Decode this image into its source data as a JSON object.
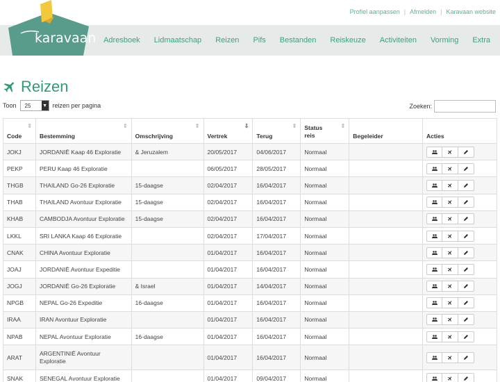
{
  "top_links": [
    "Profiel aanpassen",
    "Afmelden",
    "Karavaan website"
  ],
  "logo_text": "karavaan",
  "nav": [
    "Adresboek",
    "Lidmaatschap",
    "Reizen",
    "Pifs",
    "Bestanden",
    "Reiskeuze",
    "Activiteiten",
    "Vorming",
    "Extra"
  ],
  "page_title": "Reizen",
  "length": {
    "prefix": "Toon",
    "value": "25",
    "suffix": "reizen per pagina"
  },
  "search": {
    "label": "Zoeken:",
    "value": ""
  },
  "columns": [
    "Code",
    "Bestemming",
    "Omschrijving",
    "Vertrek",
    "Terug",
    "Status reis",
    "Begeleider",
    "Acties"
  ],
  "rows": [
    {
      "code": "JOKJ",
      "bestemming": "JORDANIË Kaap 46 Exploratie",
      "omschrijving": "& Jeruzalem",
      "vertrek": "20/05/2017",
      "terug": "04/06/2017",
      "status": "Normaal",
      "begeleider": ""
    },
    {
      "code": "PEKP",
      "bestemming": "PERU Kaap 46 Exploratie",
      "omschrijving": "",
      "vertrek": "06/05/2017",
      "terug": "28/05/2017",
      "status": "Normaal",
      "begeleider": ""
    },
    {
      "code": "THGB",
      "bestemming": "THAILAND Go-26 Exploratie",
      "omschrijving": "15-daagse",
      "vertrek": "02/04/2017",
      "terug": "16/04/2017",
      "status": "Normaal",
      "begeleider": ""
    },
    {
      "code": "THAB",
      "bestemming": "THAILAND Avontuur Exploratie",
      "omschrijving": "15-daagse",
      "vertrek": "02/04/2017",
      "terug": "16/04/2017",
      "status": "Normaal",
      "begeleider": ""
    },
    {
      "code": "KHAB",
      "bestemming": "CAMBODJA Avontuur Exploratie",
      "omschrijving": "15-daagse",
      "vertrek": "02/04/2017",
      "terug": "16/04/2017",
      "status": "Normaal",
      "begeleider": ""
    },
    {
      "code": "LKKL",
      "bestemming": "SRI LANKA Kaap 46 Exploratie",
      "omschrijving": "",
      "vertrek": "02/04/2017",
      "terug": "17/04/2017",
      "status": "Normaal",
      "begeleider": ""
    },
    {
      "code": "CNAK",
      "bestemming": "CHINA Avontuur Exploratie",
      "omschrijving": "",
      "vertrek": "01/04/2017",
      "terug": "16/04/2017",
      "status": "Normaal",
      "begeleider": ""
    },
    {
      "code": "JOAJ",
      "bestemming": "JORDANIË Avontuur Expeditie",
      "omschrijving": "",
      "vertrek": "01/04/2017",
      "terug": "16/04/2017",
      "status": "Normaal",
      "begeleider": ""
    },
    {
      "code": "JOGJ",
      "bestemming": "JORDANIË Go-26 Exploratie",
      "omschrijving": "& Israel",
      "vertrek": "01/04/2017",
      "terug": "14/04/2017",
      "status": "Normaal",
      "begeleider": ""
    },
    {
      "code": "NPGB",
      "bestemming": "NEPAL Go-26 Expeditie",
      "omschrijving": "16-daagse",
      "vertrek": "01/04/2017",
      "terug": "16/04/2017",
      "status": "Normaal",
      "begeleider": ""
    },
    {
      "code": "IRAA",
      "bestemming": "IRAN Avontuur Exploratie",
      "omschrijving": "",
      "vertrek": "01/04/2017",
      "terug": "16/04/2017",
      "status": "Normaal",
      "begeleider": ""
    },
    {
      "code": "NPAB",
      "bestemming": "NEPAL Avontuur Exploratie",
      "omschrijving": "16-daagse",
      "vertrek": "01/04/2017",
      "terug": "16/04/2017",
      "status": "Normaal",
      "begeleider": ""
    },
    {
      "code": "ARAT",
      "bestemming": "ARGENTINIË Avontuur Exploratie",
      "omschrijving": "",
      "vertrek": "01/04/2017",
      "terug": "16/04/2017",
      "status": "Normaal",
      "begeleider": ""
    },
    {
      "code": "SNAK",
      "bestemming": "SENEGAL Avontuur Exploratie",
      "omschrijving": "",
      "vertrek": "01/04/2017",
      "terug": "09/04/2017",
      "status": "Normaal",
      "begeleider": ""
    }
  ],
  "action_icons": [
    "users-icon",
    "plane-icon",
    "pencil-icon"
  ],
  "colors": {
    "brand_green": "#2f9a79",
    "link_green": "#3aa37e",
    "nav_band": "#e6eae8",
    "logo_yellow": "#f2c83c"
  }
}
